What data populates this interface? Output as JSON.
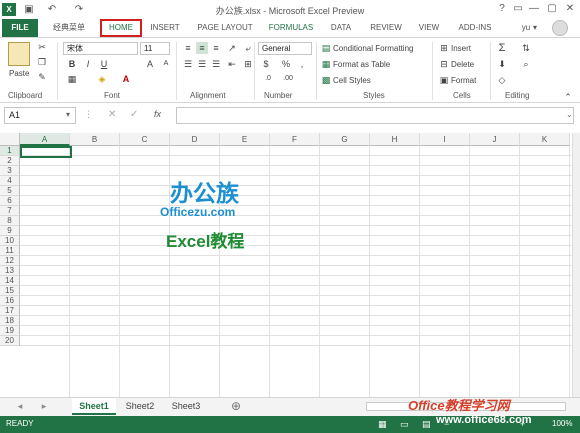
{
  "window": {
    "title": "办公族.xlsx - Microsoft Excel Preview",
    "controls": [
      "?",
      "▭",
      "—",
      "▢",
      "✕"
    ]
  },
  "tabs": [
    {
      "label": "FILE"
    },
    {
      "label": "经典菜单"
    },
    {
      "label": "HOME"
    },
    {
      "label": "INSERT"
    },
    {
      "label": "PAGE LAYOUT"
    },
    {
      "label": "FORMULAS"
    },
    {
      "label": "DATA"
    },
    {
      "label": "REVIEW"
    },
    {
      "label": "VIEW"
    },
    {
      "label": "ADD-INS"
    }
  ],
  "user": {
    "name": "yu"
  },
  "ribbon": {
    "clipboard": {
      "paste": "Paste",
      "label": "Clipboard"
    },
    "font": {
      "name": "宋体",
      "size": "11",
      "label": "Font"
    },
    "alignment": {
      "label": "Alignment"
    },
    "number": {
      "format": "General",
      "label": "Number"
    },
    "styles": {
      "conditional": "Conditional Formatting",
      "table": "Format as Table",
      "cell": "Cell Styles",
      "label": "Styles"
    },
    "cells": {
      "insert": "Insert",
      "delete": "Delete",
      "format": "Format",
      "label": "Cells"
    },
    "editing": {
      "label": "Editing"
    }
  },
  "formula_bar": {
    "namebox": "A1",
    "fx": "fx",
    "value": ""
  },
  "columns": [
    "A",
    "B",
    "C",
    "D",
    "E",
    "F",
    "G",
    "H",
    "I",
    "J",
    "K"
  ],
  "rows": [
    "1",
    "2",
    "3",
    "4",
    "5",
    "6",
    "7",
    "8",
    "9",
    "10",
    "11",
    "12",
    "13",
    "14",
    "15",
    "16",
    "17",
    "18",
    "19",
    "20"
  ],
  "watermark": {
    "logo": "办公族",
    "site": "Officezu.com",
    "excel": "Excel教程",
    "site2": "Office教程学习网",
    "url2": "www.office68.com"
  },
  "sheets": [
    {
      "label": "Sheet1"
    },
    {
      "label": "Sheet2"
    },
    {
      "label": "Sheet3"
    }
  ],
  "status": {
    "ready": "READY",
    "zoom": "100%"
  }
}
